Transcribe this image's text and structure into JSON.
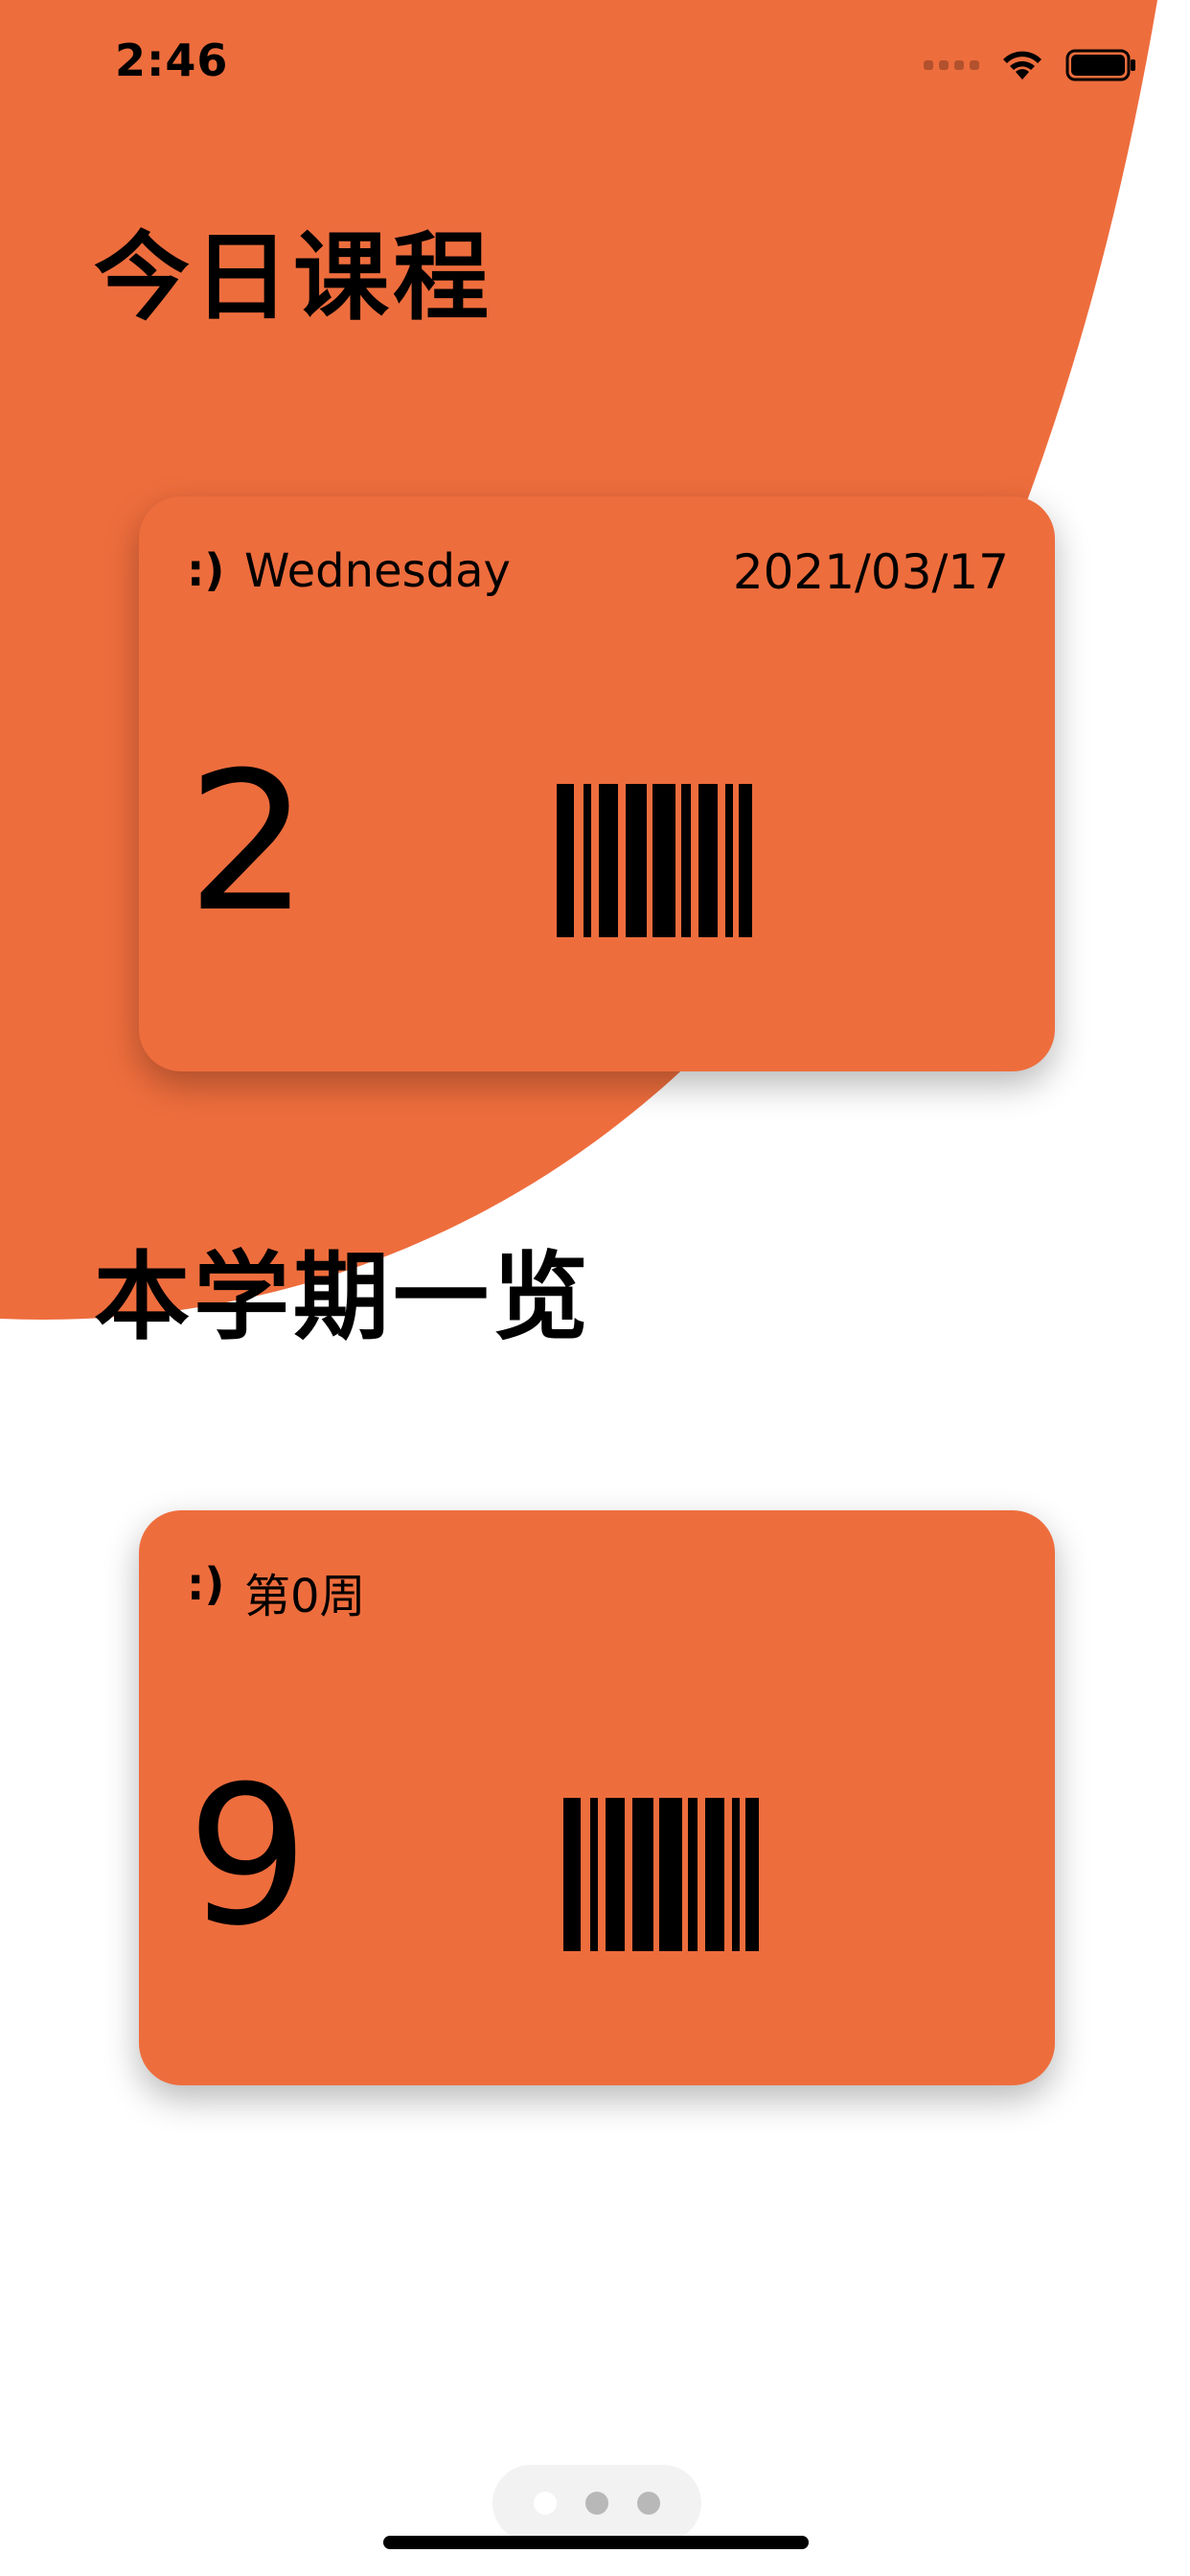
{
  "status_bar": {
    "time": "2:46"
  },
  "sections": {
    "today_title": "今日课程",
    "term_title": "本学期一览"
  },
  "today_card": {
    "smile": ":)",
    "weekday": "Wednesday",
    "date": "2021/03/17",
    "count": "2"
  },
  "term_card": {
    "smile": ":)",
    "week": "第0周",
    "count": "9"
  },
  "page_indicator": {
    "pages": 3,
    "current_page": 1
  },
  "colors": {
    "accent": "#EE6D3D",
    "background": "#FFFFFF",
    "text": "#000000"
  },
  "icons": [
    "wifi-icon",
    "battery-icon",
    "signal-icon",
    "barcode-icon"
  ]
}
